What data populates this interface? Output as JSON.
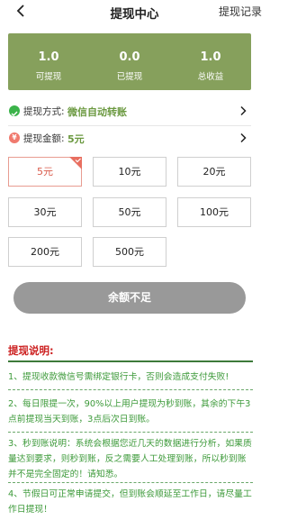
{
  "header": {
    "title": "提现中心",
    "records_link": "提现记录"
  },
  "stats": [
    {
      "value": "1.0",
      "label": "可提现"
    },
    {
      "value": "0.0",
      "label": "已提现"
    },
    {
      "value": "1.0",
      "label": "总收益"
    }
  ],
  "method": {
    "label": "提现方式:",
    "value": "微信自动转账",
    "icon": "wechat-icon"
  },
  "amount_row": {
    "label": "提现金额:",
    "value": "5元",
    "icon": "yen-icon"
  },
  "amounts": [
    {
      "label": "5元",
      "selected": true
    },
    {
      "label": "10元",
      "selected": false
    },
    {
      "label": "20元",
      "selected": false
    },
    {
      "label": "30元",
      "selected": false
    },
    {
      "label": "50元",
      "selected": false
    },
    {
      "label": "100元",
      "selected": false
    },
    {
      "label": "200元",
      "selected": false
    },
    {
      "label": "500元",
      "selected": false
    }
  ],
  "submit_label": "余额不足",
  "notes": {
    "title": "提现说明:",
    "items": [
      "1、提现收款微信号需绑定银行卡，否则会造成支付失败!",
      "2、每日限提一次，90%以上用户提现为秒到账，其余的下午3点前提现当天到账，3点后次日到账。",
      "3、秒到账说明：系统会根据您近几天的数据进行分析，如果质量达到要求，则秒到账，反之需要人工处理到账，所以秒到账并不是完全固定的！请知悉。",
      "4、节假日可正常申请提交，但到账会顺延至工作日，请尽量工作日提现！"
    ]
  },
  "colors": {
    "accent_green": "#86a05c",
    "note_green": "#3d9a3a",
    "notes_title_red": "#cc1f1f",
    "disabled_button": "#999999"
  }
}
